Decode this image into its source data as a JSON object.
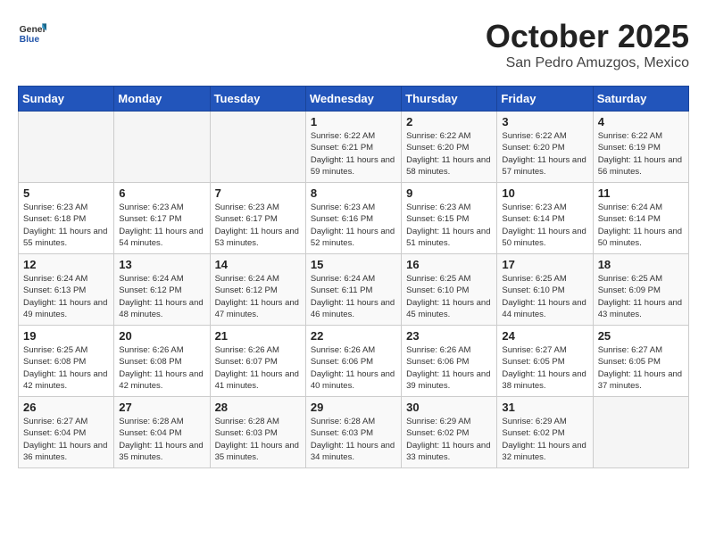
{
  "header": {
    "logo_general": "General",
    "logo_blue": "Blue",
    "month": "October 2025",
    "location": "San Pedro Amuzgos, Mexico"
  },
  "weekdays": [
    "Sunday",
    "Monday",
    "Tuesday",
    "Wednesday",
    "Thursday",
    "Friday",
    "Saturday"
  ],
  "weeks": [
    [
      {
        "day": "",
        "info": ""
      },
      {
        "day": "",
        "info": ""
      },
      {
        "day": "",
        "info": ""
      },
      {
        "day": "1",
        "info": "Sunrise: 6:22 AM\nSunset: 6:21 PM\nDaylight: 11 hours\nand 59 minutes."
      },
      {
        "day": "2",
        "info": "Sunrise: 6:22 AM\nSunset: 6:20 PM\nDaylight: 11 hours\nand 58 minutes."
      },
      {
        "day": "3",
        "info": "Sunrise: 6:22 AM\nSunset: 6:20 PM\nDaylight: 11 hours\nand 57 minutes."
      },
      {
        "day": "4",
        "info": "Sunrise: 6:22 AM\nSunset: 6:19 PM\nDaylight: 11 hours\nand 56 minutes."
      }
    ],
    [
      {
        "day": "5",
        "info": "Sunrise: 6:23 AM\nSunset: 6:18 PM\nDaylight: 11 hours\nand 55 minutes."
      },
      {
        "day": "6",
        "info": "Sunrise: 6:23 AM\nSunset: 6:17 PM\nDaylight: 11 hours\nand 54 minutes."
      },
      {
        "day": "7",
        "info": "Sunrise: 6:23 AM\nSunset: 6:17 PM\nDaylight: 11 hours\nand 53 minutes."
      },
      {
        "day": "8",
        "info": "Sunrise: 6:23 AM\nSunset: 6:16 PM\nDaylight: 11 hours\nand 52 minutes."
      },
      {
        "day": "9",
        "info": "Sunrise: 6:23 AM\nSunset: 6:15 PM\nDaylight: 11 hours\nand 51 minutes."
      },
      {
        "day": "10",
        "info": "Sunrise: 6:23 AM\nSunset: 6:14 PM\nDaylight: 11 hours\nand 50 minutes."
      },
      {
        "day": "11",
        "info": "Sunrise: 6:24 AM\nSunset: 6:14 PM\nDaylight: 11 hours\nand 50 minutes."
      }
    ],
    [
      {
        "day": "12",
        "info": "Sunrise: 6:24 AM\nSunset: 6:13 PM\nDaylight: 11 hours\nand 49 minutes."
      },
      {
        "day": "13",
        "info": "Sunrise: 6:24 AM\nSunset: 6:12 PM\nDaylight: 11 hours\nand 48 minutes."
      },
      {
        "day": "14",
        "info": "Sunrise: 6:24 AM\nSunset: 6:12 PM\nDaylight: 11 hours\nand 47 minutes."
      },
      {
        "day": "15",
        "info": "Sunrise: 6:24 AM\nSunset: 6:11 PM\nDaylight: 11 hours\nand 46 minutes."
      },
      {
        "day": "16",
        "info": "Sunrise: 6:25 AM\nSunset: 6:10 PM\nDaylight: 11 hours\nand 45 minutes."
      },
      {
        "day": "17",
        "info": "Sunrise: 6:25 AM\nSunset: 6:10 PM\nDaylight: 11 hours\nand 44 minutes."
      },
      {
        "day": "18",
        "info": "Sunrise: 6:25 AM\nSunset: 6:09 PM\nDaylight: 11 hours\nand 43 minutes."
      }
    ],
    [
      {
        "day": "19",
        "info": "Sunrise: 6:25 AM\nSunset: 6:08 PM\nDaylight: 11 hours\nand 42 minutes."
      },
      {
        "day": "20",
        "info": "Sunrise: 6:26 AM\nSunset: 6:08 PM\nDaylight: 11 hours\nand 42 minutes."
      },
      {
        "day": "21",
        "info": "Sunrise: 6:26 AM\nSunset: 6:07 PM\nDaylight: 11 hours\nand 41 minutes."
      },
      {
        "day": "22",
        "info": "Sunrise: 6:26 AM\nSunset: 6:06 PM\nDaylight: 11 hours\nand 40 minutes."
      },
      {
        "day": "23",
        "info": "Sunrise: 6:26 AM\nSunset: 6:06 PM\nDaylight: 11 hours\nand 39 minutes."
      },
      {
        "day": "24",
        "info": "Sunrise: 6:27 AM\nSunset: 6:05 PM\nDaylight: 11 hours\nand 38 minutes."
      },
      {
        "day": "25",
        "info": "Sunrise: 6:27 AM\nSunset: 6:05 PM\nDaylight: 11 hours\nand 37 minutes."
      }
    ],
    [
      {
        "day": "26",
        "info": "Sunrise: 6:27 AM\nSunset: 6:04 PM\nDaylight: 11 hours\nand 36 minutes."
      },
      {
        "day": "27",
        "info": "Sunrise: 6:28 AM\nSunset: 6:04 PM\nDaylight: 11 hours\nand 35 minutes."
      },
      {
        "day": "28",
        "info": "Sunrise: 6:28 AM\nSunset: 6:03 PM\nDaylight: 11 hours\nand 35 minutes."
      },
      {
        "day": "29",
        "info": "Sunrise: 6:28 AM\nSunset: 6:03 PM\nDaylight: 11 hours\nand 34 minutes."
      },
      {
        "day": "30",
        "info": "Sunrise: 6:29 AM\nSunset: 6:02 PM\nDaylight: 11 hours\nand 33 minutes."
      },
      {
        "day": "31",
        "info": "Sunrise: 6:29 AM\nSunset: 6:02 PM\nDaylight: 11 hours\nand 32 minutes."
      },
      {
        "day": "",
        "info": ""
      }
    ]
  ]
}
